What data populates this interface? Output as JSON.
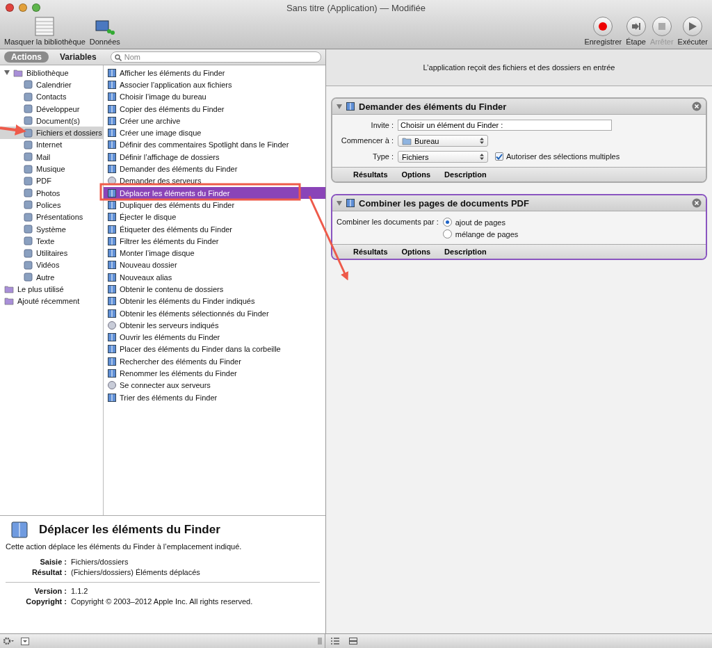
{
  "window": {
    "title": "Sans titre (Application) — Modifiée"
  },
  "toolbar": {
    "left": [
      {
        "label": "Masquer la bibliothèque",
        "kind": "library"
      },
      {
        "label": "Données",
        "kind": "media"
      }
    ],
    "right": [
      {
        "label": "Enregistrer",
        "kind": "record",
        "disabled": false
      },
      {
        "label": "Étape",
        "kind": "step",
        "disabled": false
      },
      {
        "label": "Arrêter",
        "kind": "stop",
        "disabled": true
      },
      {
        "label": "Exécuter",
        "kind": "run",
        "disabled": false
      }
    ]
  },
  "library_tabs": [
    {
      "label": "Actions",
      "selected": true
    },
    {
      "label": "Variables",
      "selected": false
    }
  ],
  "search": {
    "placeholder": "Nom"
  },
  "sidebar": {
    "items": [
      {
        "label": "Bibliothèque",
        "expanded": true,
        "selected": false,
        "children": [
          {
            "label": "Calendrier",
            "selected": false
          },
          {
            "label": "Contacts",
            "selected": false
          },
          {
            "label": "Développeur",
            "selected": false
          },
          {
            "label": "Document(s)",
            "selected": false
          },
          {
            "label": "Fichiers et dossiers",
            "selected": true
          },
          {
            "label": "Internet",
            "selected": false
          },
          {
            "label": "Mail",
            "selected": false
          },
          {
            "label": "Musique",
            "selected": false
          },
          {
            "label": "PDF",
            "selected": false
          },
          {
            "label": "Photos",
            "selected": false
          },
          {
            "label": "Polices",
            "selected": false
          },
          {
            "label": "Présentations",
            "selected": false
          },
          {
            "label": "Système",
            "selected": false
          },
          {
            "label": "Texte",
            "selected": false
          },
          {
            "label": "Utilitaires",
            "selected": false
          },
          {
            "label": "Vidéos",
            "selected": false
          },
          {
            "label": "Autre",
            "selected": false
          }
        ]
      },
      {
        "label": "Le plus utilisé",
        "selected": false
      },
      {
        "label": "Ajouté récemment",
        "selected": false
      }
    ]
  },
  "actions": [
    {
      "label": "Afficher les éléments du Finder",
      "kind": "finder",
      "selected": false
    },
    {
      "label": "Associer l’application aux fichiers",
      "kind": "finder",
      "selected": false
    },
    {
      "label": "Choisir l’image du bureau",
      "kind": "finder",
      "selected": false
    },
    {
      "label": "Copier des éléments du Finder",
      "kind": "finder",
      "selected": false
    },
    {
      "label": "Créer une archive",
      "kind": "finder",
      "selected": false
    },
    {
      "label": "Créer une image disque",
      "kind": "finder",
      "selected": false
    },
    {
      "label": "Définir des commentaires Spotlight dans le Finder",
      "kind": "finder",
      "selected": false
    },
    {
      "label": "Définir l’affichage de dossiers",
      "kind": "finder",
      "selected": false
    },
    {
      "label": "Demander des éléments du Finder",
      "kind": "finder",
      "selected": false
    },
    {
      "label": "Demander des serveurs",
      "kind": "server",
      "selected": false
    },
    {
      "label": "Déplacer les éléments du Finder",
      "kind": "finder",
      "selected": true
    },
    {
      "label": "Dupliquer des éléments du Finder",
      "kind": "finder",
      "selected": false
    },
    {
      "label": "Éjecter le disque",
      "kind": "finder",
      "selected": false
    },
    {
      "label": "Étiqueter des éléments du Finder",
      "kind": "finder",
      "selected": false
    },
    {
      "label": "Filtrer les éléments du Finder",
      "kind": "finder",
      "selected": false
    },
    {
      "label": "Monter l’image disque",
      "kind": "finder",
      "selected": false
    },
    {
      "label": "Nouveau dossier",
      "kind": "finder",
      "selected": false
    },
    {
      "label": "Nouveaux alias",
      "kind": "finder",
      "selected": false
    },
    {
      "label": "Obtenir le contenu de dossiers",
      "kind": "finder",
      "selected": false
    },
    {
      "label": "Obtenir les éléments du Finder indiqués",
      "kind": "finder",
      "selected": false
    },
    {
      "label": "Obtenir les éléments sélectionnés du Finder",
      "kind": "finder",
      "selected": false
    },
    {
      "label": "Obtenir les serveurs indiqués",
      "kind": "server",
      "selected": false
    },
    {
      "label": "Ouvrir les éléments du Finder",
      "kind": "finder",
      "selected": false
    },
    {
      "label": "Placer des éléments du Finder dans la corbeille",
      "kind": "finder",
      "selected": false
    },
    {
      "label": "Rechercher des éléments du Finder",
      "kind": "finder",
      "selected": false
    },
    {
      "label": "Renommer les éléments du Finder",
      "kind": "finder",
      "selected": false
    },
    {
      "label": "Se connecter aux serveurs",
      "kind": "server",
      "selected": false
    },
    {
      "label": "Trier des éléments du Finder",
      "kind": "finder",
      "selected": false
    }
  ],
  "description": {
    "title": "Déplacer les éléments du Finder",
    "text": "Cette action déplace les éléments du Finder à l’emplacement indiqué.",
    "fields": [
      {
        "label": "Saisie :",
        "value": "Fichiers/dossiers"
      },
      {
        "label": "Résultat :",
        "value": "(Fichiers/dossiers) Éléments déplacés"
      }
    ],
    "meta": [
      {
        "label": "Version :",
        "value": "1.1.2"
      },
      {
        "label": "Copyright :",
        "value": "Copyright © 2003–2012 Apple Inc.  All rights reserved."
      }
    ]
  },
  "workflow": {
    "input_note": "L’application reçoit des fichiers et des dossiers en entrée",
    "cards": [
      {
        "title": "Demander des éléments du Finder",
        "selected": false,
        "rows": [
          {
            "kind": "text",
            "label": "Invite :",
            "value": "Choisir un élément du Finder :"
          },
          {
            "kind": "popup",
            "label": "Commencer à :",
            "value": "Bureau",
            "folder": true
          },
          {
            "kind": "popup",
            "label": "Type :",
            "value": "Fichiers",
            "folder": false,
            "checkbox": {
              "label": "Autoriser des sélections multiples",
              "checked": true
            }
          }
        ],
        "footer": [
          "Résultats",
          "Options",
          "Description"
        ]
      },
      {
        "title": "Combiner les pages de documents PDF",
        "selected": true,
        "rows": [
          {
            "kind": "radio",
            "label": "Combiner les documents par :",
            "options": [
              {
                "label": "ajout de pages",
                "selected": true
              },
              {
                "label": "mélange de pages",
                "selected": false
              }
            ]
          }
        ],
        "footer": [
          "Résultats",
          "Options",
          "Description"
        ]
      }
    ]
  }
}
